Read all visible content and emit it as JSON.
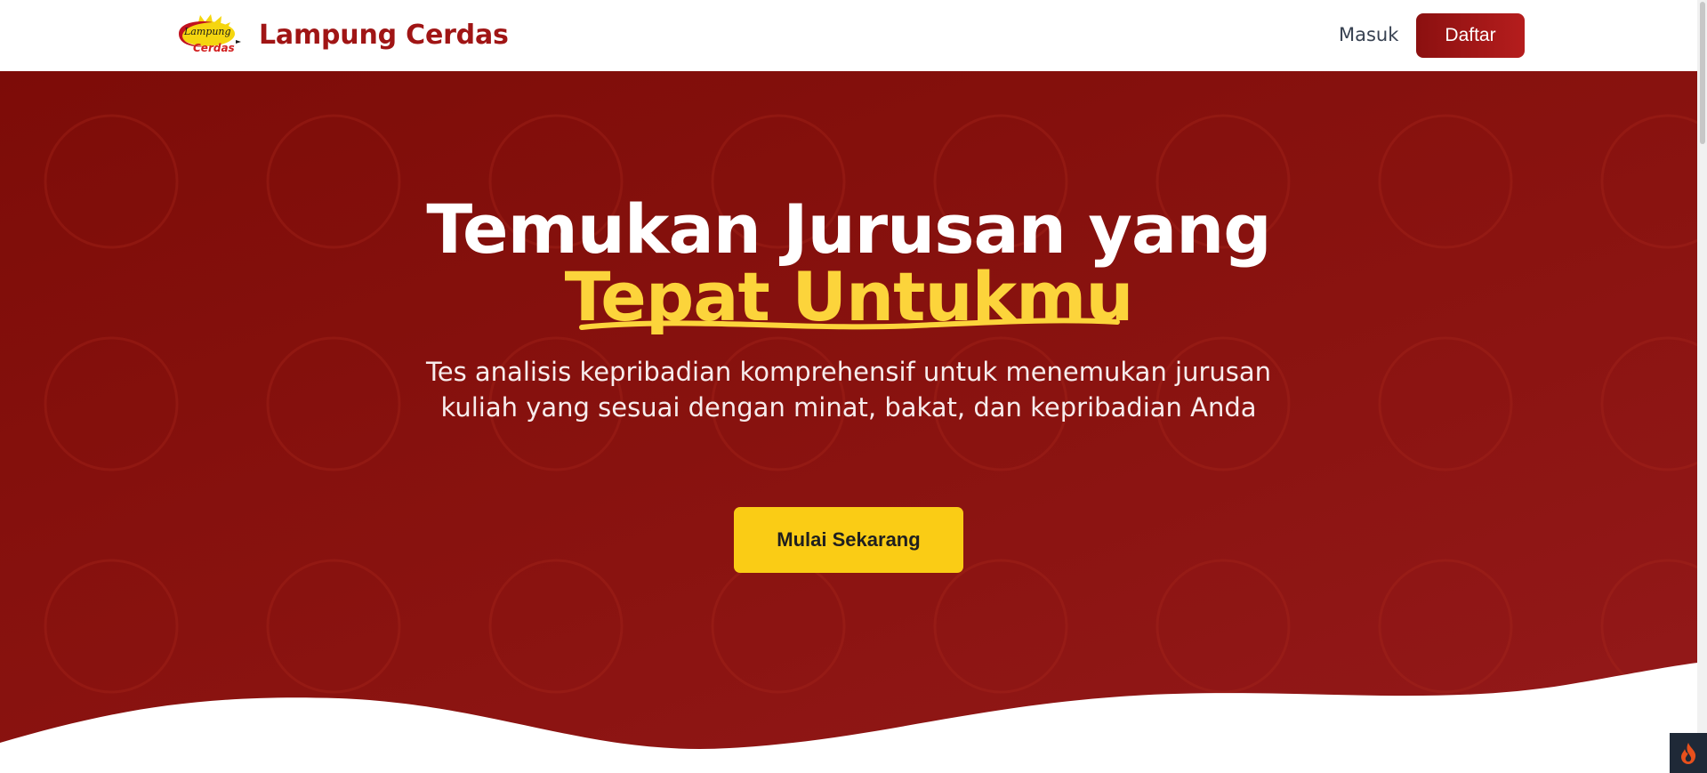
{
  "header": {
    "brand_name": "Lampung Cerdas",
    "logo_text_top": "Lampung",
    "logo_text_bottom": "Cerdas",
    "login_label": "Masuk",
    "register_label": "Daftar"
  },
  "hero": {
    "title_line1": "Temukan Jurusan yang",
    "title_highlight": "Tepat Untukmu",
    "description": "Tes analisis kepribadian komprehensif untuk menemukan jurusan kuliah yang sesuai dengan minat, bakat, dan kepribadian Anda",
    "cta_label": "Mulai Sekarang"
  },
  "colors": {
    "brand": "#a01515",
    "hero_bg": "#8a1310",
    "accent": "#fcd43b",
    "cta": "#facc15"
  },
  "icons": {
    "logo": "lampung-cerdas-logo",
    "corner": "flame-icon"
  }
}
